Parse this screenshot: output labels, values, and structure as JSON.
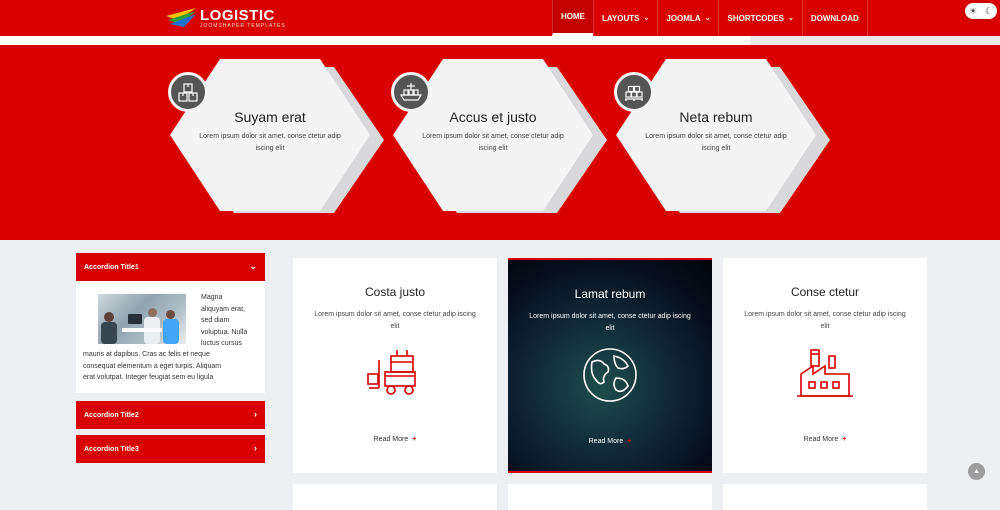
{
  "header": {
    "logo_title": "LOGISTIC",
    "logo_sub": "JOOMSHAPER TEMPLATES",
    "nav": [
      {
        "label": "HOME",
        "chevron": false,
        "active": true
      },
      {
        "label": "LAYOUTS",
        "chevron": true,
        "active": false
      },
      {
        "label": "JOOMLA",
        "chevron": true,
        "active": false
      },
      {
        "label": "SHORTCODES",
        "chevron": true,
        "active": false
      },
      {
        "label": "DOWNLOAD",
        "chevron": false,
        "active": false
      }
    ],
    "theme_toggle": {
      "sun": "☀",
      "moon": "☾"
    }
  },
  "features": [
    {
      "title": "Suyam erat",
      "text": "Lorem ipsum dolor sit amet, conse ctetur adip iscing elit",
      "icon": "boxes-icon"
    },
    {
      "title": "Accus et justo",
      "text": "Lorem ipsum dolor sit amet, conse ctetur adip iscing elit",
      "icon": "ship-icon"
    },
    {
      "title": "Neta rebum",
      "text": "Lorem ipsum dolor sit amet, conse ctetur adip iscing elit",
      "icon": "pallet-icon"
    }
  ],
  "accordion": {
    "items": [
      {
        "title": "Accordion Title1",
        "arrow": "⌄",
        "open": true
      },
      {
        "title": "Accordion Title2",
        "arrow": "›",
        "open": false
      },
      {
        "title": "Accordion Title3",
        "arrow": "›",
        "open": false
      }
    ],
    "body_lines_right": [
      "Magna",
      "aliquyam erat,",
      "sed diam",
      "voluptua. Nulla",
      "luctus cursus"
    ],
    "body_lines_full": [
      "mauris at dapibus. Cras ac felis et neque",
      "consequat elementum a eget turpis. Aliquam",
      "erat volutpat. Integer feugiat sem eu ligula"
    ]
  },
  "services": [
    {
      "title": "Costa justo",
      "text": "Lorem ipsum dolor sit amet, conse ctetur adip iscing elit",
      "link": "Read More",
      "plus": "+",
      "icon": "forklift-icon",
      "dark": false
    },
    {
      "title": "Lamat rebum",
      "text": "Lorem ipsum dolor sit amet, conse ctetur adip iscing elit",
      "link": "Read More",
      "plus": "+",
      "icon": "globe-icon",
      "dark": true
    },
    {
      "title": "Conse ctetur",
      "text": "Lorem ipsum dolor sit amet, conse ctetur adip iscing elit",
      "link": "Read More",
      "plus": "+",
      "icon": "factory-icon",
      "dark": false
    }
  ],
  "scroll_top": "▲",
  "colors": {
    "brand_red": "#d80000",
    "page_bg": "#eeeff3",
    "hex_bg": "#f4f4f4",
    "icon_circle": "#555555"
  }
}
